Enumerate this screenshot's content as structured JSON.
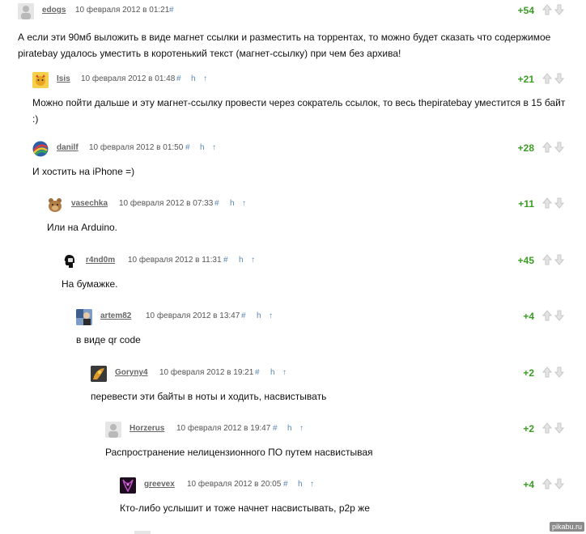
{
  "comments": [
    {
      "username": "edogs",
      "timestamp": "10 февраля 2012 в 01:21",
      "hash": "#",
      "score": "+54",
      "text": "А если эти 90мб выложить в виде магнет ссылки и разместить на торрентах, то можно будет сказать что содержимое piratebay удалось уместить в коротенький текст (магнет-ссылку) при чем без архива!"
    },
    {
      "username": "Isis",
      "timestamp": "10 февраля 2012 в 01:48",
      "hash": "#",
      "parent": "h",
      "up": "↑",
      "score": "+21",
      "text": "Можно пойти дальше и эту магнет-ссылку провести через сократель ссылок, то весь thepiratebay уместится в 15 байт :)"
    },
    {
      "username": "danilf",
      "timestamp": "10 февраля 2012 в 01:50",
      "hash": "#",
      "parent": "h",
      "up": "↑",
      "score": "+28",
      "text": "И хостить на iPhone =)"
    },
    {
      "username": "vasechka",
      "timestamp": "10 февраля 2012 в 07:33",
      "hash": "#",
      "parent": "h",
      "up": "↑",
      "score": "+11",
      "text": "Или на Arduino."
    },
    {
      "username": "r4nd0m",
      "timestamp": "10 февраля 2012 в 11:31",
      "hash": "#",
      "parent": "h",
      "up": "↑",
      "score": "+45",
      "text": "На бумажке."
    },
    {
      "username": "artem82",
      "timestamp": "10 февраля 2012 в 13:47",
      "hash": "#",
      "parent": "h",
      "up": "↑",
      "score": "+4",
      "text": "в виде qr code"
    },
    {
      "username": "Goryny4",
      "timestamp": "10 февраля 2012 в 19:21",
      "hash": "#",
      "parent": "h",
      "up": "↑",
      "score": "+2",
      "text": "перевести эти байты в ноты и ходить, насвистывать"
    },
    {
      "username": "Horzerus",
      "timestamp": "10 февраля 2012 в 19:47",
      "hash": "#",
      "parent": "h",
      "up": "↑",
      "score": "+2",
      "text": "Распространение нелицензионного ПО путем насвистывая"
    },
    {
      "username": "greevex",
      "timestamp": "10 февраля 2012 в 20:05",
      "hash": "#",
      "parent": "h",
      "up": "↑",
      "score": "+4",
      "text": "Кто-либо услышит и тоже начнет насвистывать, р2р же"
    }
  ],
  "colors": {
    "score": "#3a9d23",
    "link": "#5b87b5",
    "username": "#666666"
  },
  "watermark": "pikabu.ru"
}
